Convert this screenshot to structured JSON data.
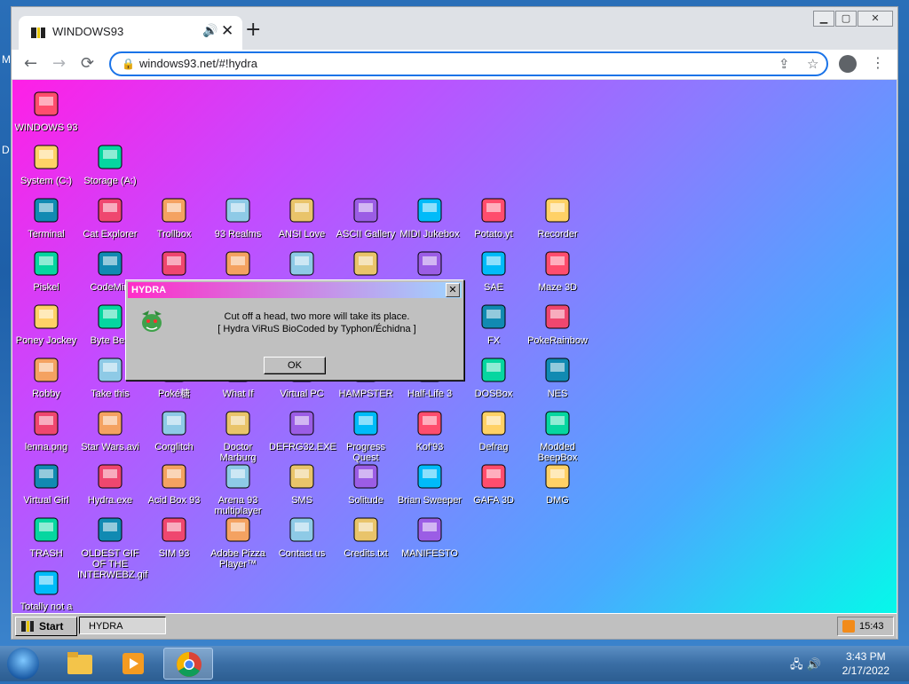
{
  "host": {
    "edge_labels": [
      "M",
      "D"
    ]
  },
  "chrome": {
    "tab": {
      "title": "WINDOWS93",
      "close": "✕",
      "audio": "🔊"
    },
    "new_tab": "+",
    "window_controls": [
      "▁",
      "▢",
      "✕"
    ],
    "nav": {
      "back": "←",
      "forward": "→",
      "reload": "⟳"
    },
    "url": "windows93.net/#!hydra",
    "lock": "🔒",
    "share": "⇪",
    "bookmark": "☆",
    "menu": "⋮"
  },
  "desktop": {
    "icons": [
      {
        "label": "WINDOWS 93",
        "icon": "computer-icon",
        "col": 0,
        "row": 0
      },
      {
        "label": "System (C:)",
        "icon": "drive-icon",
        "col": 0,
        "row": 1
      },
      {
        "label": "Storage (A:)",
        "icon": "floppy-drive-icon",
        "col": 1,
        "row": 1
      },
      {
        "label": "Terminal",
        "icon": "terminal-icon",
        "col": 0,
        "row": 2
      },
      {
        "label": "Cat Explorer",
        "icon": "cat-globe-icon",
        "col": 1,
        "row": 2
      },
      {
        "label": "Trollbox",
        "icon": "trollbox-icon",
        "col": 2,
        "row": 2
      },
      {
        "label": "93 Realms",
        "icon": "dragon-icon",
        "col": 3,
        "row": 2
      },
      {
        "label": "ANSI Love",
        "icon": "ansi-icon",
        "col": 4,
        "row": 2
      },
      {
        "label": "ASCII Gallery",
        "icon": "ascii-icon",
        "col": 5,
        "row": 2
      },
      {
        "label": "MIDI Jukebox",
        "icon": "piano-icon",
        "col": 6,
        "row": 2
      },
      {
        "label": "Potato.yt",
        "icon": "potato-icon",
        "col": 7,
        "row": 2
      },
      {
        "label": "Recorder",
        "icon": "microphone-icon",
        "col": 8,
        "row": 2
      },
      {
        "label": "Piskel",
        "icon": "palette-icon",
        "col": 0,
        "row": 3
      },
      {
        "label": "CodeMirr",
        "icon": "codemirror-icon",
        "col": 1,
        "row": 3
      },
      {
        "label": "",
        "icon": "cube-icon",
        "col": 2,
        "row": 3
      },
      {
        "label": "",
        "icon": "teapot-icon",
        "col": 3,
        "row": 3
      },
      {
        "label": "",
        "icon": "keyboard-icon",
        "col": 4,
        "row": 3
      },
      {
        "label": "",
        "icon": "banana-icon",
        "col": 5,
        "row": 3
      },
      {
        "label": "",
        "icon": "speaker-icon",
        "col": 6,
        "row": 3
      },
      {
        "label": "SAE",
        "icon": "ball-icon",
        "col": 7,
        "row": 3
      },
      {
        "label": "Maze 3D",
        "icon": "maze-icon",
        "col": 8,
        "row": 3
      },
      {
        "label": "Poney Jockey",
        "icon": "pony-icon",
        "col": 0,
        "row": 4
      },
      {
        "label": "Byte Bea",
        "icon": "bytebeat-icon",
        "col": 1,
        "row": 4
      },
      {
        "label": "FX",
        "icon": "atom-icon",
        "col": 7,
        "row": 4
      },
      {
        "label": "PokeRainbow",
        "icon": "pokerainbow-icon",
        "col": 8,
        "row": 4
      },
      {
        "label": "Robby",
        "icon": "stickman-icon",
        "col": 0,
        "row": 5
      },
      {
        "label": "Take this",
        "icon": "wizard-icon",
        "col": 1,
        "row": 5
      },
      {
        "label": "Poké糖",
        "icon": "poke-icon",
        "col": 2,
        "row": 5
      },
      {
        "label": "What If",
        "icon": "whatif-icon",
        "col": 3,
        "row": 5
      },
      {
        "label": "Virtual PC",
        "icon": "virtualpc-icon",
        "col": 4,
        "row": 5
      },
      {
        "label": "HAMPSTER",
        "icon": "hampster-icon",
        "col": 5,
        "row": 5
      },
      {
        "label": "Half-Life 3",
        "icon": "halflife-icon",
        "col": 6,
        "row": 5
      },
      {
        "label": "DOSBox",
        "icon": "dosbox-icon",
        "col": 7,
        "row": 5
      },
      {
        "label": "NES",
        "icon": "nes-icon",
        "col": 8,
        "row": 5
      },
      {
        "label": "lenna.png",
        "icon": "image-file-icon",
        "col": 0,
        "row": 6
      },
      {
        "label": "Star Wars.avi",
        "icon": "yoda-icon",
        "col": 1,
        "row": 6
      },
      {
        "label": "Corglitch",
        "icon": "corgi-icon",
        "col": 2,
        "row": 6
      },
      {
        "label": "Doctor Marburg",
        "icon": "doctor-icon",
        "col": 3,
        "row": 6
      },
      {
        "label": "DEFRG32.EXE",
        "icon": "monitor-face-icon",
        "col": 4,
        "row": 6
      },
      {
        "label": "Progress Quest",
        "icon": "swords-icon",
        "col": 5,
        "row": 6
      },
      {
        "label": "Kof'93",
        "icon": "fighter-icon",
        "col": 6,
        "row": 6
      },
      {
        "label": "Defrag",
        "icon": "defrag-icon",
        "col": 7,
        "row": 6
      },
      {
        "label": "Modded BeepBox",
        "icon": "ring-icon",
        "col": 8,
        "row": 6
      },
      {
        "label": "Virtual Girl",
        "icon": "girl-icon",
        "col": 0,
        "row": 7
      },
      {
        "label": "Hydra.exe",
        "icon": "hydra-icon",
        "col": 1,
        "row": 7
      },
      {
        "label": "Acid Box 93",
        "icon": "smiley-icon",
        "col": 2,
        "row": 7
      },
      {
        "label": "Arena 93 multiplayer",
        "icon": "arena-cube-icon",
        "col": 3,
        "row": 7
      },
      {
        "label": "SMS",
        "icon": "sms-icon",
        "col": 4,
        "row": 7
      },
      {
        "label": "Solitude",
        "icon": "solitude-icon",
        "col": 5,
        "row": 7
      },
      {
        "label": "Brian Sweeper",
        "icon": "mine-icon",
        "col": 6,
        "row": 7
      },
      {
        "label": "GAFA 3D",
        "icon": "face-3d-icon",
        "col": 7,
        "row": 7
      },
      {
        "label": "DMG",
        "icon": "dmg-icon",
        "col": 8,
        "row": 7
      },
      {
        "label": "TRASH",
        "icon": "trash-icon",
        "col": 0,
        "row": 8
      },
      {
        "label": "OLDEST GIF OF THE INTERWEBZ.gif",
        "icon": "gif-file-icon",
        "col": 1,
        "row": 8
      },
      {
        "label": "SIM 93",
        "icon": "sim-icon",
        "col": 2,
        "row": 8
      },
      {
        "label": "Adobe Pizza Player™",
        "icon": "pizza-icon",
        "col": 3,
        "row": 8
      },
      {
        "label": "Contact us",
        "icon": "contact-icon",
        "col": 4,
        "row": 8
      },
      {
        "label": "Credits.txt",
        "icon": "text-file-icon",
        "col": 5,
        "row": 8
      },
      {
        "label": "MANIFESTO",
        "icon": "question-icon",
        "col": 6,
        "row": 8
      },
      {
        "label": "Totally not a",
        "icon": "dolphin-icon",
        "col": 0,
        "row": 9
      }
    ]
  },
  "dialog": {
    "title": "HYDRA",
    "close": "✕",
    "line1": "Cut off a head, two more will take its place.",
    "line2": "[ Hydra ViRuS BioCoded by Typhon/Échidna ]",
    "ok": "OK"
  },
  "w93_taskbar": {
    "start": "Start",
    "task": "HYDRA",
    "time": "15:43"
  },
  "win7_taskbar": {
    "time": "3:43 PM",
    "date": "2/17/2022"
  }
}
